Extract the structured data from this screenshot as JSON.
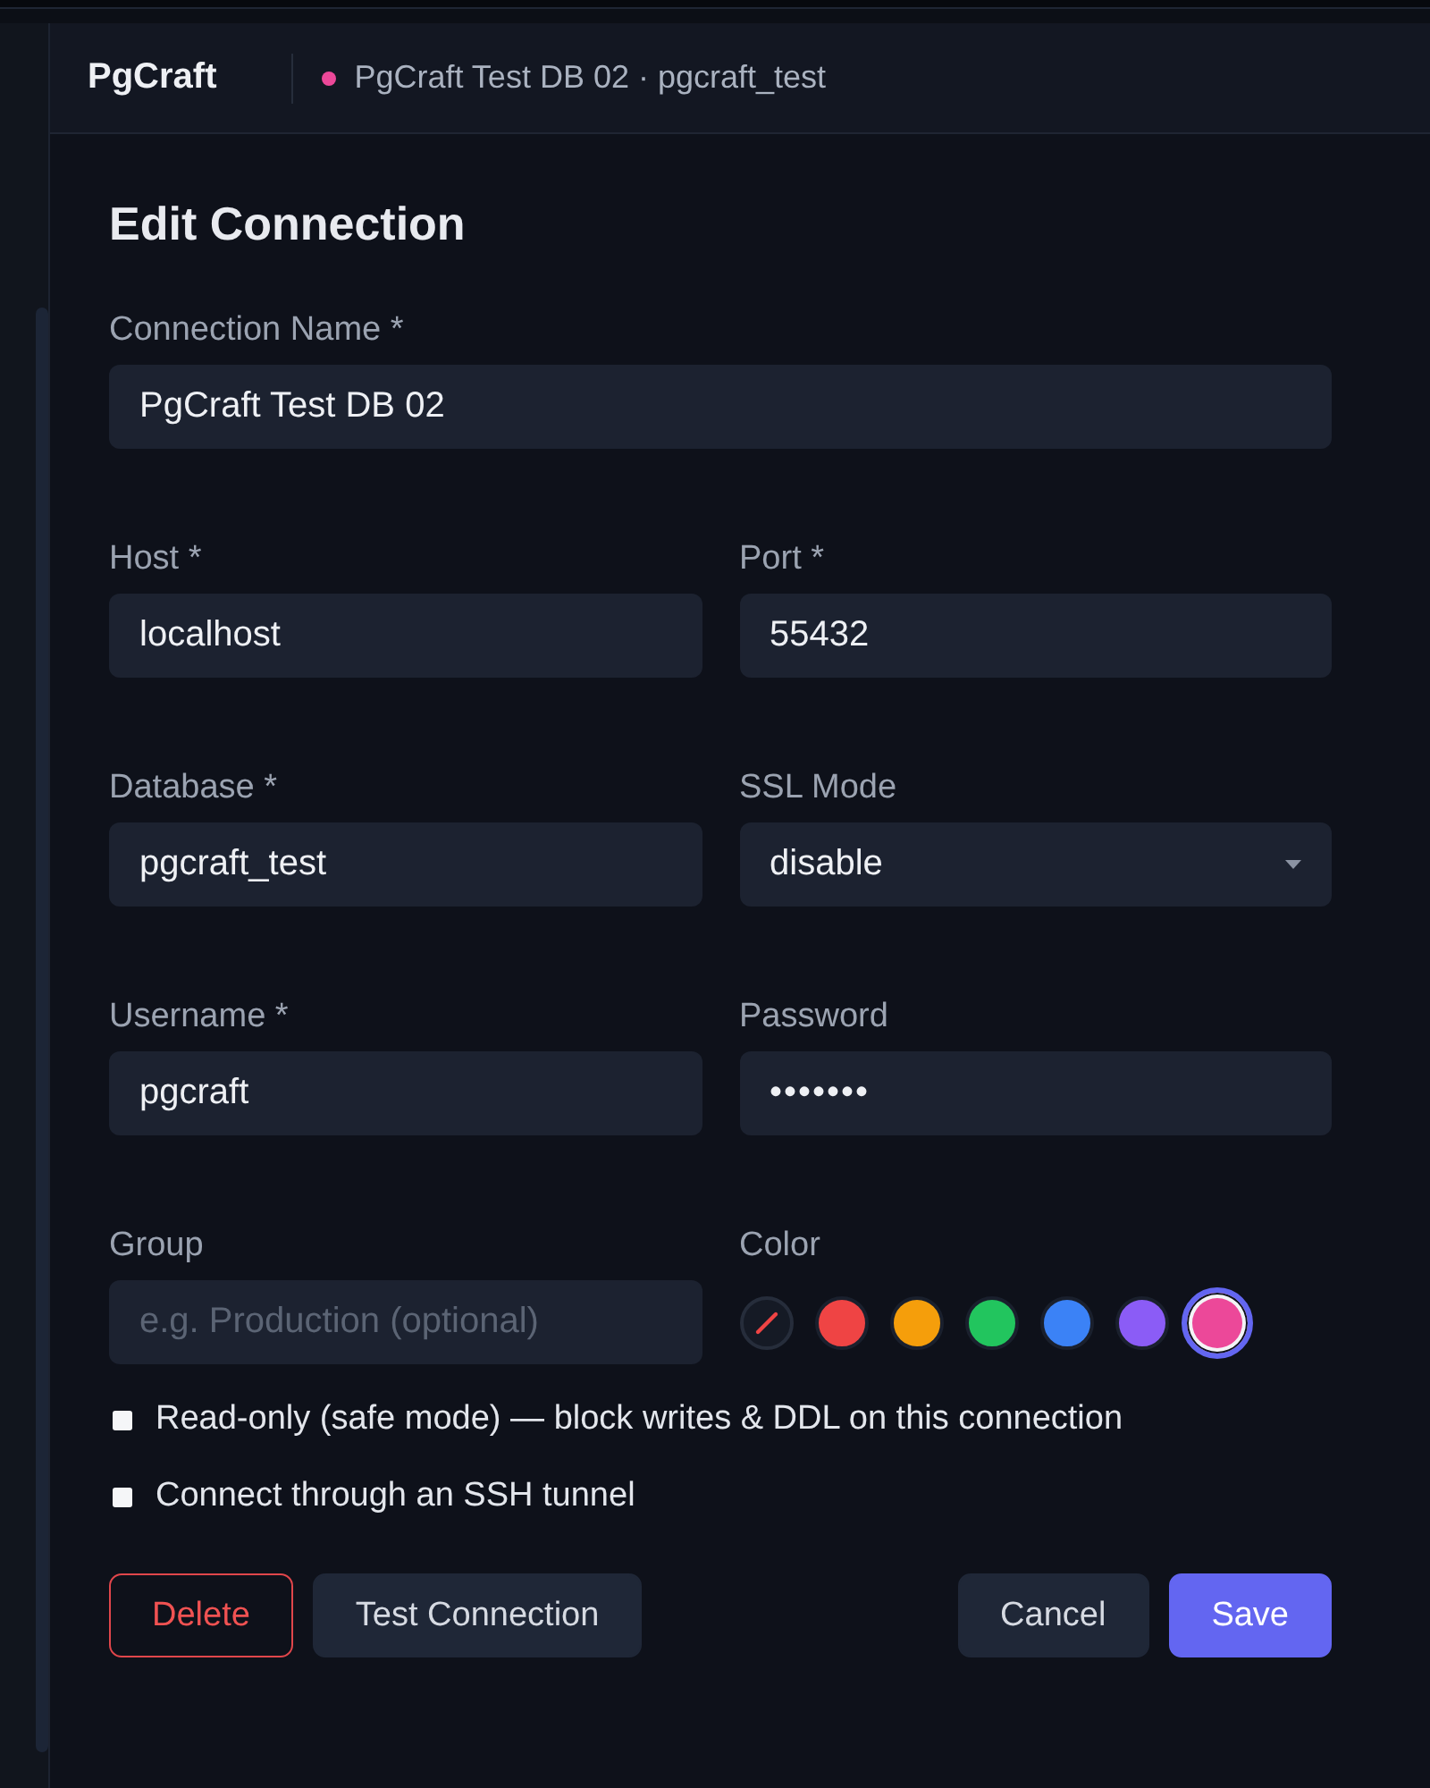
{
  "app": {
    "name": "PgCraft"
  },
  "connection": {
    "label": "PgCraft Test DB 02 · pgcraft_test",
    "color": "#ec4899"
  },
  "form": {
    "title": "Edit Connection",
    "rows": [
      [
        {
          "kind": "text",
          "label": "Connection Name *",
          "value": "PgCraft Test DB 02"
        }
      ],
      [
        {
          "kind": "text",
          "label": "Host *",
          "value": "localhost"
        },
        {
          "kind": "text",
          "label": "Port *",
          "value": "55432"
        }
      ],
      [
        {
          "kind": "text",
          "label": "Database *",
          "value": "pgcraft_test"
        },
        {
          "kind": "select",
          "label": "SSL Mode",
          "value": "disable"
        }
      ],
      [
        {
          "kind": "text",
          "label": "Username *",
          "value": "pgcraft"
        },
        {
          "kind": "password",
          "label": "Password",
          "value": "•••••••"
        }
      ],
      [
        {
          "kind": "text",
          "label": "Group",
          "placeholder": "e.g. Production (optional)"
        },
        {
          "kind": "color",
          "label": "Color",
          "swatches": [
            {
              "kind": "none",
              "selected": false
            },
            {
              "kind": "color",
              "color": "#ef4444",
              "selected": false
            },
            {
              "kind": "color",
              "color": "#f59e0b",
              "selected": false
            },
            {
              "kind": "color",
              "color": "#22c55e",
              "selected": false
            },
            {
              "kind": "color",
              "color": "#3b82f6",
              "selected": false
            },
            {
              "kind": "color",
              "color": "#8b5cf6",
              "selected": false
            },
            {
              "kind": "color",
              "color": "#ec4899",
              "selected": true
            }
          ]
        }
      ]
    ],
    "options": [
      {
        "label": "Read-only (safe mode) — block writes & DDL on this connection",
        "checked": false
      },
      {
        "label": "Connect through an SSH tunnel",
        "checked": false
      }
    ],
    "actions": {
      "left": [
        {
          "label": "Delete",
          "kind": "danger"
        },
        {
          "label": "Test Connection",
          "kind": "secondary"
        }
      ],
      "right": [
        {
          "label": "Cancel",
          "kind": "secondary"
        },
        {
          "label": "Save",
          "kind": "primary"
        }
      ]
    }
  }
}
